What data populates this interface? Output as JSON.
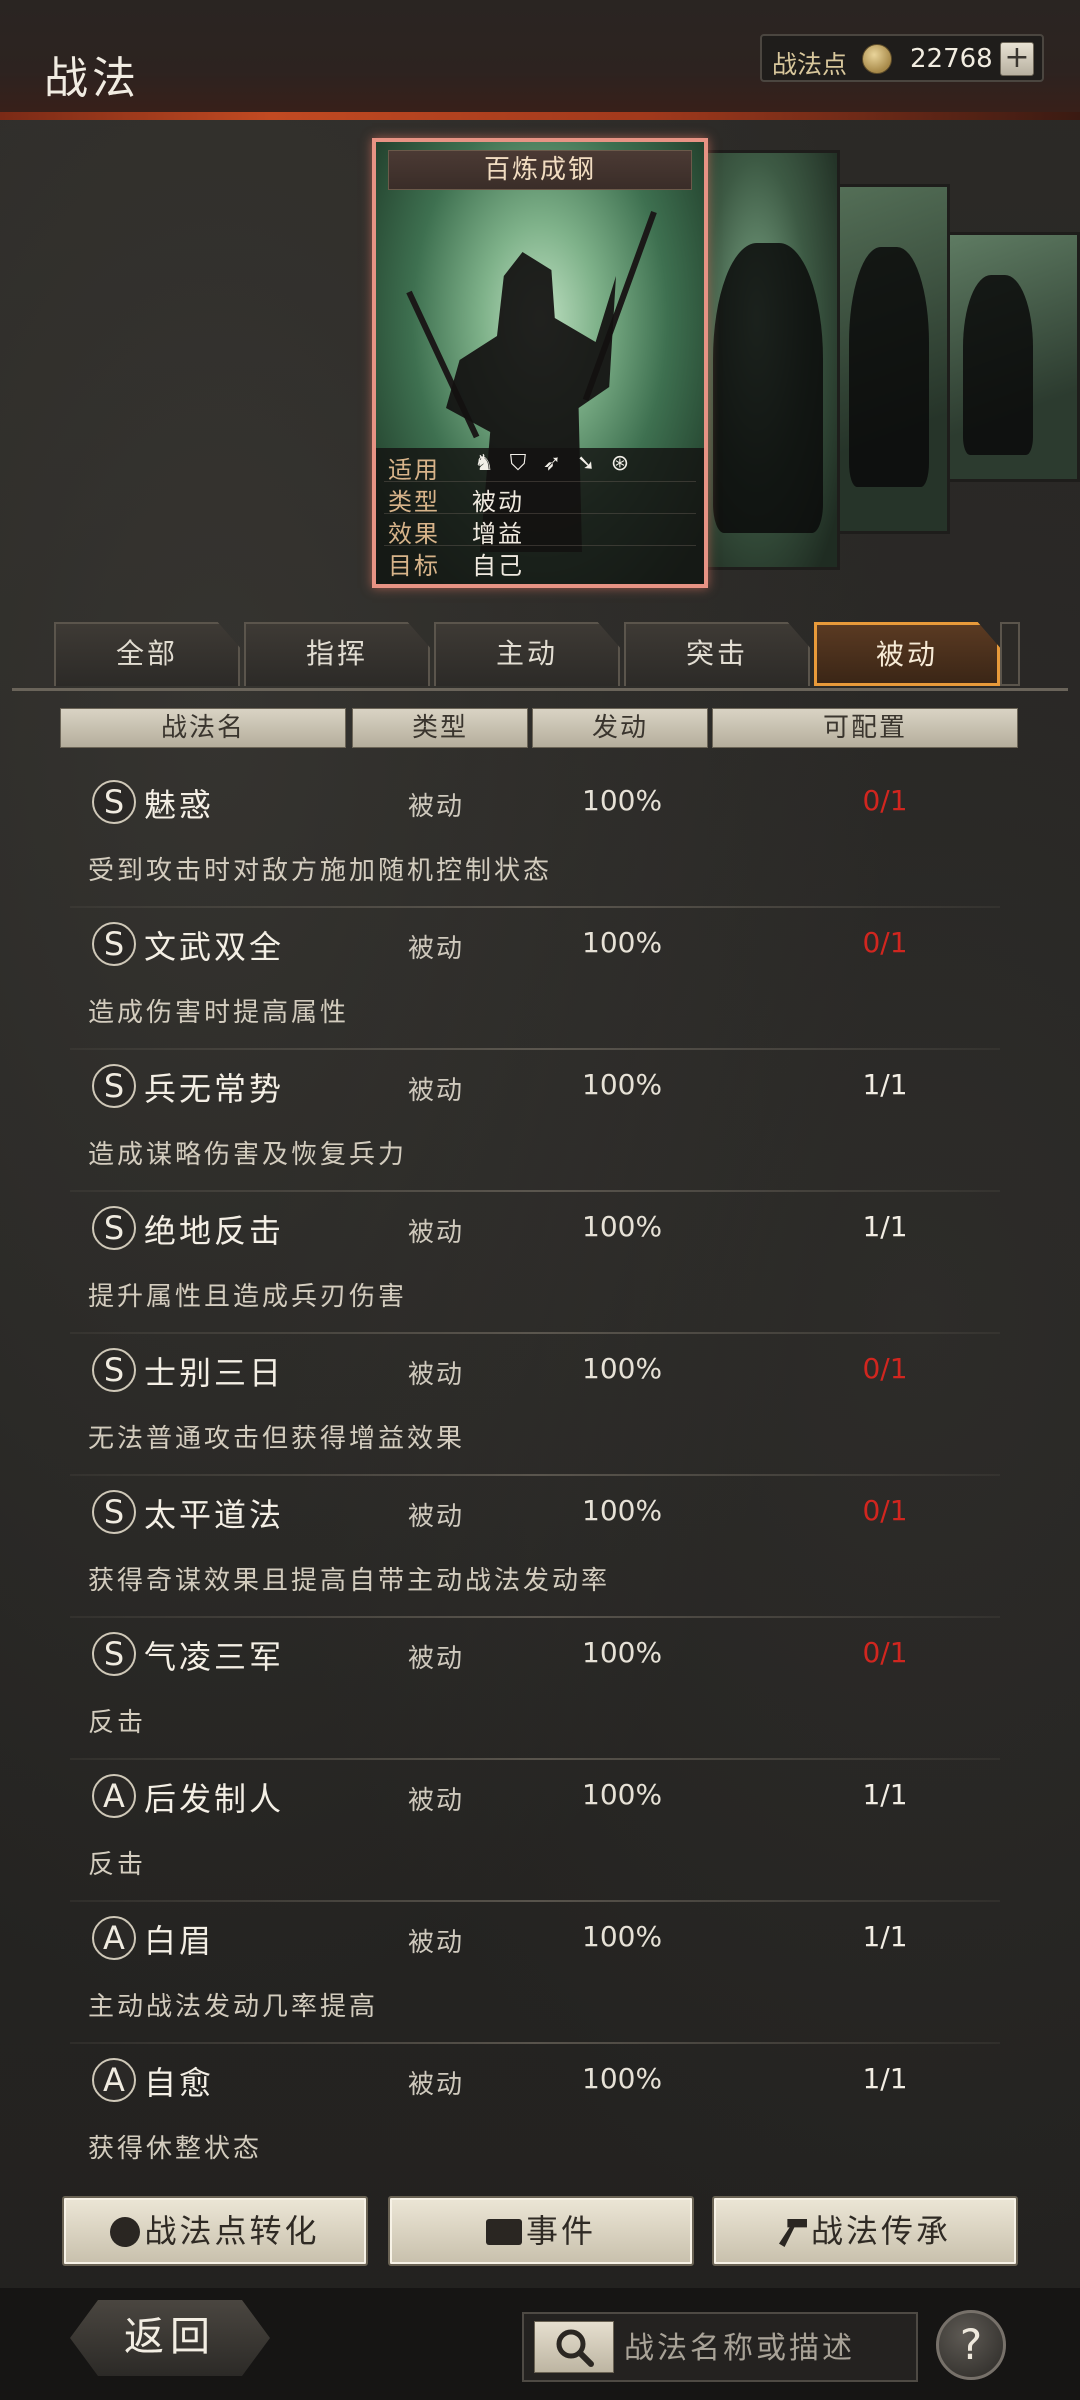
{
  "header": {
    "title": "战法",
    "points_label": "战法点",
    "points_value": "22768",
    "add_label": "+"
  },
  "card": {
    "title": "百炼成钢",
    "rows": [
      {
        "label": "适用",
        "value": ""
      },
      {
        "label": "类型",
        "value": "被动"
      },
      {
        "label": "效果",
        "value": "增益"
      },
      {
        "label": "目标",
        "value": "自己"
      }
    ],
    "troop_icons": [
      "cavalry-icon",
      "shield-icon",
      "bow-icon",
      "spear-icon",
      "wheel-icon"
    ]
  },
  "tabs": [
    {
      "label": "全部",
      "active": false
    },
    {
      "label": "指挥",
      "active": false
    },
    {
      "label": "主动",
      "active": false
    },
    {
      "label": "突击",
      "active": false
    },
    {
      "label": "被动",
      "active": true
    }
  ],
  "columns": [
    "战法名",
    "类型",
    "发动",
    "可配置"
  ],
  "tactics": [
    {
      "grade": "S",
      "name": "魅惑",
      "type": "被动",
      "rate": "100%",
      "slots": "0/1",
      "desc": "受到攻击时对敌方施加随机控制状态"
    },
    {
      "grade": "S",
      "name": "文武双全",
      "type": "被动",
      "rate": "100%",
      "slots": "0/1",
      "desc": "造成伤害时提高属性"
    },
    {
      "grade": "S",
      "name": "兵无常势",
      "type": "被动",
      "rate": "100%",
      "slots": "1/1",
      "desc": "造成谋略伤害及恢复兵力"
    },
    {
      "grade": "S",
      "name": "绝地反击",
      "type": "被动",
      "rate": "100%",
      "slots": "1/1",
      "desc": "提升属性且造成兵刃伤害"
    },
    {
      "grade": "S",
      "name": "士别三日",
      "type": "被动",
      "rate": "100%",
      "slots": "0/1",
      "desc": "无法普通攻击但获得增益效果"
    },
    {
      "grade": "S",
      "name": "太平道法",
      "type": "被动",
      "rate": "100%",
      "slots": "0/1",
      "desc": "获得奇谋效果且提高自带主动战法发动率"
    },
    {
      "grade": "S",
      "name": "气凌三军",
      "type": "被动",
      "rate": "100%",
      "slots": "0/1",
      "desc": "反击"
    },
    {
      "grade": "A",
      "name": "后发制人",
      "type": "被动",
      "rate": "100%",
      "slots": "1/1",
      "desc": "反击"
    },
    {
      "grade": "A",
      "name": "白眉",
      "type": "被动",
      "rate": "100%",
      "slots": "1/1",
      "desc": "主动战法发动几率提高"
    },
    {
      "grade": "A",
      "name": "自愈",
      "type": "被动",
      "rate": "100%",
      "slots": "1/1",
      "desc": "获得休整状态"
    }
  ],
  "actions": {
    "convert": "战法点转化",
    "event": "事件",
    "inherit": "战法传承"
  },
  "footer": {
    "back": "返回",
    "search_placeholder": "战法名称或描述",
    "help": "?"
  },
  "colors": {
    "accent": "#e89a3a",
    "empty_slot": "#d1261f",
    "header_red": "#c24a22"
  }
}
